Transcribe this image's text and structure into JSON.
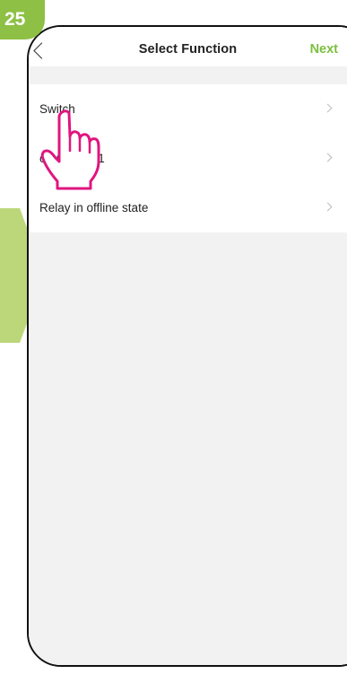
{
  "step_badge": "25",
  "header": {
    "title": "Select Function",
    "next_label": "Next"
  },
  "list": [
    {
      "label": "Switch"
    },
    {
      "label": "countdown1"
    },
    {
      "label": "Relay in offline state"
    }
  ],
  "icons": {
    "back": "chevron-left-icon",
    "row": "chevron-right-icon",
    "pointer": "pointing-hand-icon"
  },
  "colors": {
    "accent": "#7cbf3f",
    "badge": "#8dc044",
    "arrow": "#bcd77a",
    "hand": "#e0157f"
  }
}
